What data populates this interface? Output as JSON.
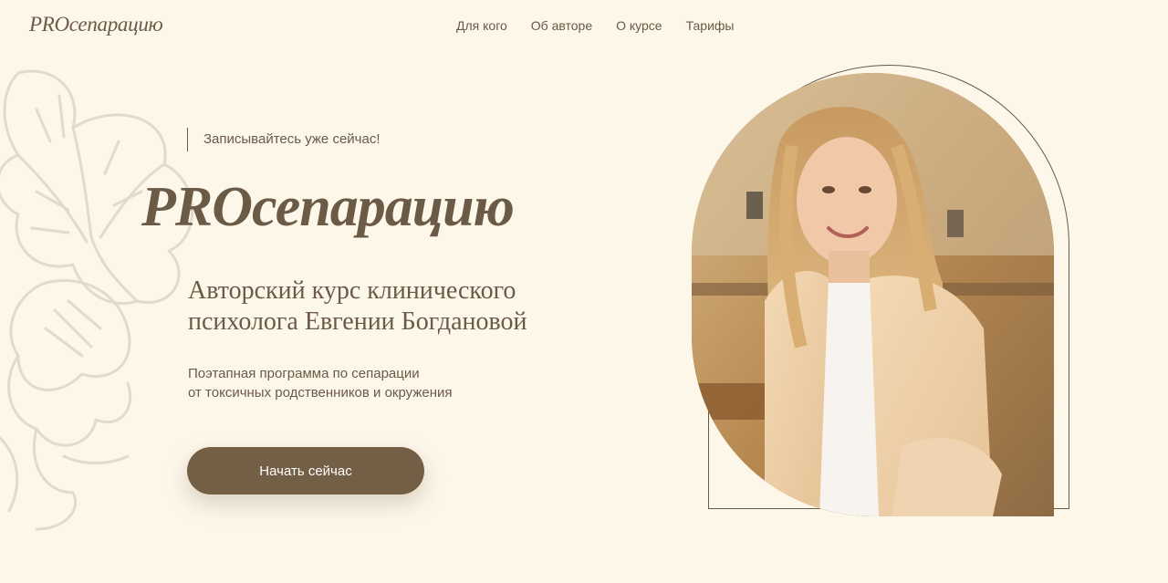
{
  "header": {
    "logo": "PROсепарацию",
    "nav": [
      {
        "label": "Для кого"
      },
      {
        "label": "Об авторе"
      },
      {
        "label": "О курсе"
      },
      {
        "label": "Тарифы"
      }
    ]
  },
  "hero": {
    "tagline": "Записывайтесь уже сейчас!",
    "title": "PROсепарацию",
    "subtitle_lines": [
      "Авторский курс клинического",
      "психолога Евгении Богдановой"
    ],
    "description_lines": [
      "Поэтапная программа по сепарации",
      "от токсичных родственников и окружения"
    ],
    "cta_label": "Начать сейчас"
  },
  "colors": {
    "background": "#fdf7ea",
    "text": "#6b5a45",
    "button": "#735f45",
    "floral": "#e3d9cc"
  }
}
